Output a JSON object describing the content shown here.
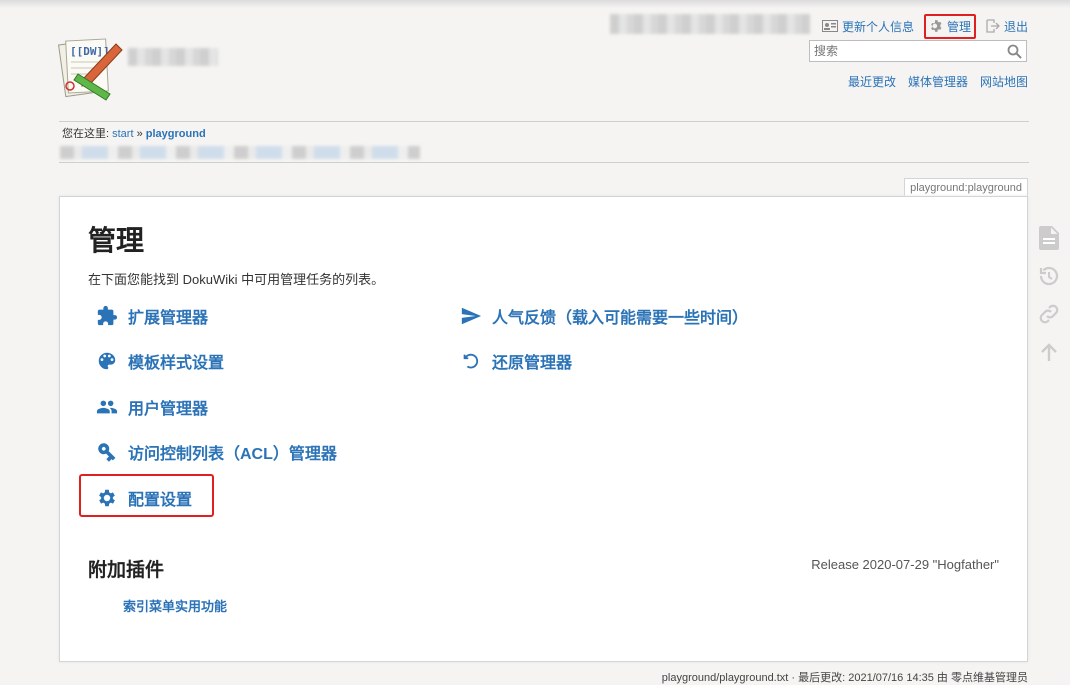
{
  "user_tools": {
    "update_profile": "更新个人信息",
    "admin": "管理",
    "logout": "退出"
  },
  "search": {
    "placeholder": "搜索"
  },
  "site_tools": {
    "recent": "最近更改",
    "media": "媒体管理器",
    "sitemap": "网站地图"
  },
  "breadcrumb": {
    "prefix": "您在这里:",
    "start": "start",
    "sep": "»",
    "current": "playground"
  },
  "page_id": "playground:playground",
  "main": {
    "title": "管理",
    "intro": "在下面您能找到 DokuWiki 中可用管理任务的列表。",
    "admin_items_left": [
      {
        "label": "扩展管理器",
        "icon": "puzzle-icon"
      },
      {
        "label": "模板样式设置",
        "icon": "palette-icon"
      },
      {
        "label": "用户管理器",
        "icon": "users-icon"
      },
      {
        "label": "访问控制列表（ACL）管理器",
        "icon": "key-icon"
      },
      {
        "label": "配置设置",
        "icon": "gear-icon"
      }
    ],
    "admin_items_right": [
      {
        "label": "人气反馈（载入可能需要一些时间）",
        "icon": "send-icon"
      },
      {
        "label": "还原管理器",
        "icon": "undo-icon"
      }
    ],
    "addons_title": "附加插件",
    "release": "Release 2020-07-29 \"Hogfather\"",
    "plugin_link": "索引菜单实用功能"
  },
  "footer": "playground/playground.txt · 最后更改: 2021/07/16 14:35 由 零点维基管理员",
  "colors": {
    "link": "#2b73b7",
    "highlight": "#e02020",
    "background": "#f5f4f2"
  }
}
